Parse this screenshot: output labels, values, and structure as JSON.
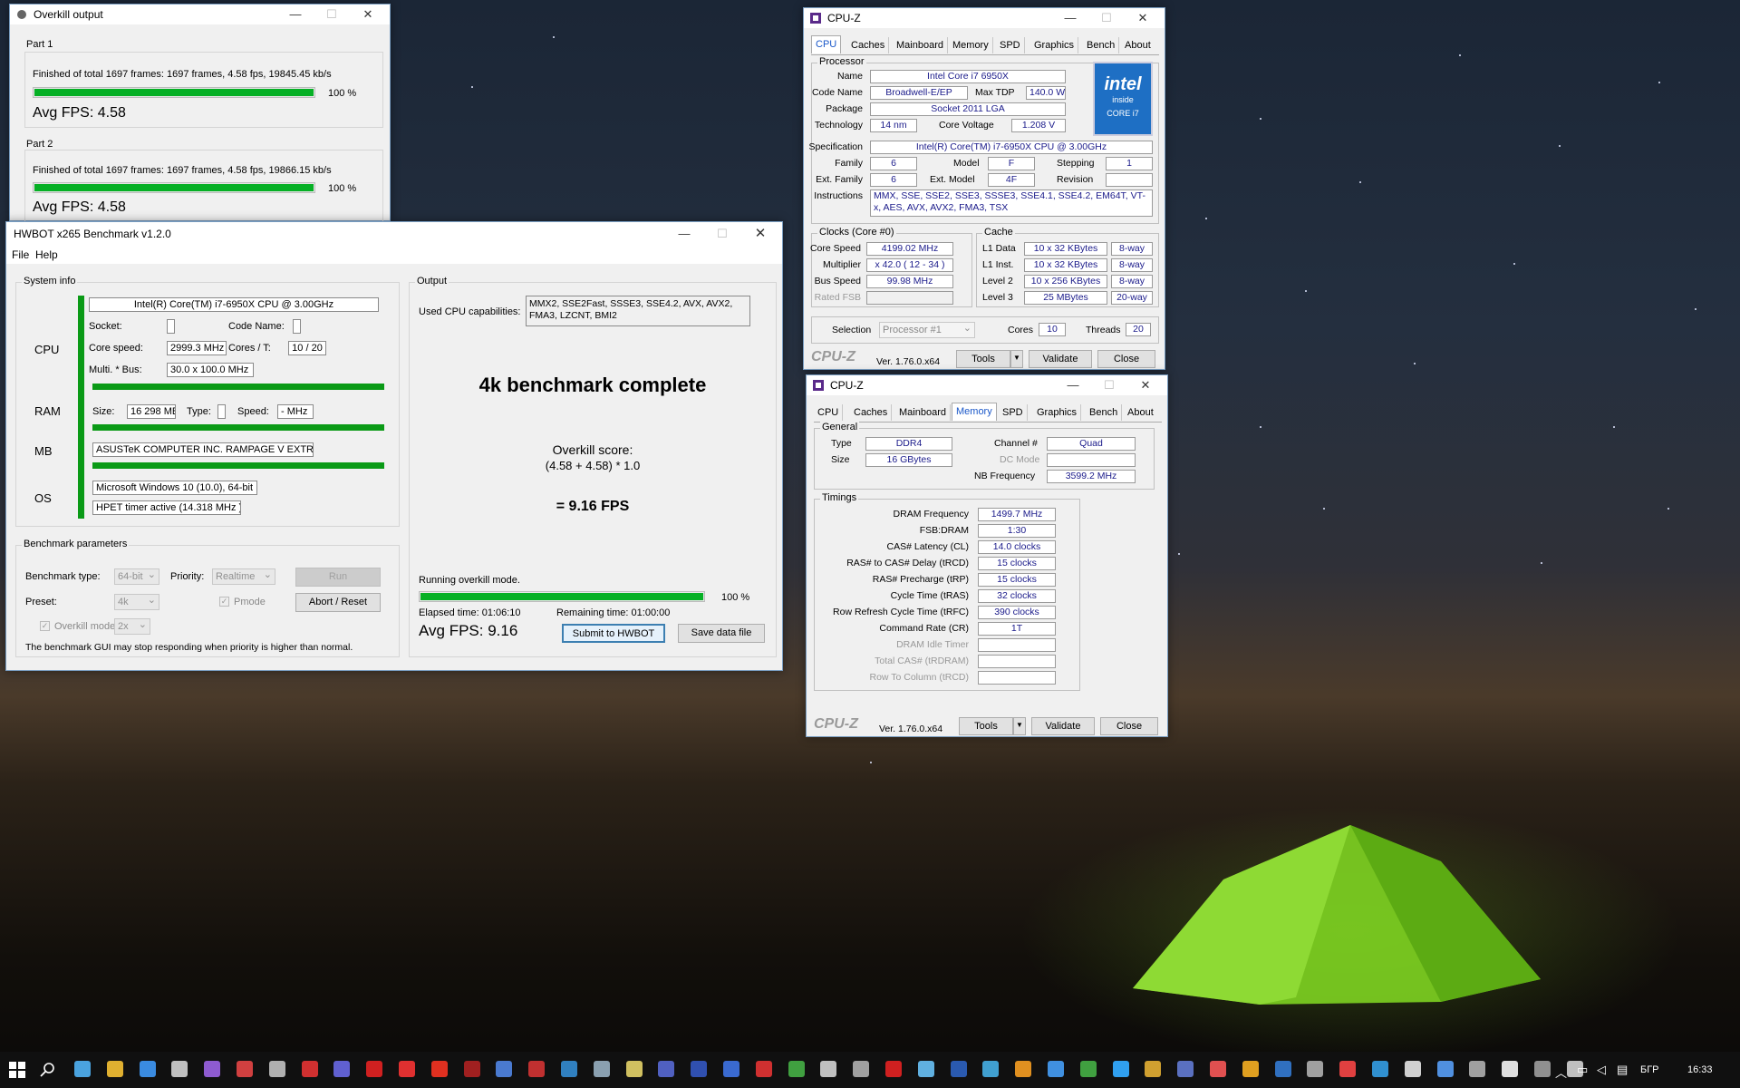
{
  "overkill": {
    "title": "Overkill output",
    "part1": {
      "label": "Part 1",
      "status": "Finished of total 1697 frames: 1697 frames, 4.58 fps,  19845.45 kb/s",
      "pct": "100 %",
      "progress": 1.0,
      "avg": "Avg FPS: 4.58"
    },
    "part2": {
      "label": "Part 2",
      "status": "Finished of total 1697 frames: 1697 frames, 4.58 fps,  19866.15 kb/s",
      "pct": "100 %",
      "progress": 1.0,
      "avg": "Avg FPS: 4.58"
    }
  },
  "hwbot": {
    "title": "HWBOT x265 Benchmark v1.2.0",
    "menu": [
      "File",
      "Help"
    ],
    "sysinfo": {
      "group": "System info",
      "cpu_label": "CPU",
      "ram_label": "RAM",
      "mb_label": "MB",
      "os_label": "OS",
      "cpu_name": "Intel(R) Core(TM) i7-6950X CPU @ 3.00GHz",
      "socket_label": "Socket:",
      "socket": "",
      "codename_label": "Code Name:",
      "codename": "",
      "corespeed_label": "Core speed:",
      "corespeed": "2999.3 MHz",
      "cores_label": "Cores / T:",
      "cores": "10 / 20",
      "multi_label": "Multi. * Bus:",
      "multi": "30.0 x 100.0 MHz",
      "size_label": "Size:",
      "size": "16 298 MB",
      "type_label": "Type:",
      "type": "",
      "speed_label": "Speed:",
      "speed": "- MHz",
      "mb": "ASUSTeK COMPUTER INC. RAMPAGE V EXTREME",
      "os": "Microsoft Windows 10 (10.0), 64-bit",
      "timer": "HPET timer active (14.318 MHz )"
    },
    "params": {
      "group": "Benchmark parameters",
      "type_label": "Benchmark type:",
      "type": "64-bit",
      "priority_label": "Priority:",
      "priority": "Realtime",
      "run": "Run",
      "preset_label": "Preset:",
      "preset": "4k",
      "pmode": "Pmode",
      "abort": "Abort / Reset",
      "overkill_label": "Overkill mode",
      "overkill": "2x",
      "warning": "The benchmark GUI may stop responding when priority is higher than normal."
    },
    "output": {
      "group": "Output",
      "caps_label": "Used CPU capabilities:",
      "caps": "MMX2, SSE2Fast, SSSE3, SSE4.2, AVX, AVX2, FMA3, LZCNT, BMI2",
      "headline": "4k benchmark complete",
      "score_label": "Overkill score:",
      "score_formula": "(4.58 + 4.58) * 1.0",
      "result": "= 9.16 FPS",
      "running": "Running overkill mode.",
      "pct": "100 %",
      "progress": 1.0,
      "elapsed": "Elapsed time: 01:06:10",
      "remaining": "Remaining time: 01:00:00",
      "avg": "Avg FPS: 9.16",
      "submit": "Submit to HWBOT",
      "save": "Save data file"
    }
  },
  "cpuz1": {
    "title": "CPU-Z",
    "tabs": [
      "CPU",
      "Caches",
      "Mainboard",
      "Memory",
      "SPD",
      "Graphics",
      "Bench",
      "About"
    ],
    "active": "CPU",
    "processor": {
      "group": "Processor",
      "name_label": "Name",
      "name": "Intel Core i7 6950X",
      "codename_label": "Code Name",
      "codename": "Broadwell-E/EP",
      "tdp_label": "Max TDP",
      "tdp": "140.0 W",
      "package_label": "Package",
      "package": "Socket 2011 LGA",
      "tech_label": "Technology",
      "tech": "14 nm",
      "voltage_label": "Core Voltage",
      "voltage": "1.208 V",
      "spec_label": "Specification",
      "spec": "Intel(R) Core(TM) i7-6950X CPU @ 3.00GHz",
      "family_label": "Family",
      "family": "6",
      "model_label": "Model",
      "model": "F",
      "stepping_label": "Stepping",
      "stepping": "1",
      "extfamily_label": "Ext. Family",
      "extfamily": "6",
      "extmodel_label": "Ext. Model",
      "extmodel": "4F",
      "revision_label": "Revision",
      "revision": "",
      "instr_label": "Instructions",
      "instr": "MMX, SSE, SSE2, SSE3, SSSE3, SSE4.1, SSE4.2, EM64T, VT-x, AES, AVX, AVX2, FMA3, TSX"
    },
    "logo": {
      "brand": "intel",
      "inside": "inside",
      "line": "CORE i7"
    },
    "clocks": {
      "group": "Clocks (Core #0)",
      "core_label": "Core Speed",
      "core": "4199.02 MHz",
      "mult_label": "Multiplier",
      "mult": "x 42.0 ( 12 - 34 )",
      "bus_label": "Bus Speed",
      "bus": "99.98 MHz",
      "fsb_label": "Rated FSB",
      "fsb": ""
    },
    "cache": {
      "group": "Cache",
      "l1d_label": "L1 Data",
      "l1d": "10 x 32 KBytes",
      "l1d_w": "8-way",
      "l1i_label": "L1 Inst.",
      "l1i": "10 x 32 KBytes",
      "l1i_w": "8-way",
      "l2_label": "Level 2",
      "l2": "10 x 256 KBytes",
      "l2_w": "8-way",
      "l3_label": "Level 3",
      "l3": "25 MBytes",
      "l3_w": "20-way"
    },
    "sel_label": "Selection",
    "sel": "Processor #1",
    "cores_label": "Cores",
    "cores": "10",
    "threads_label": "Threads",
    "threads": "20",
    "brand": "CPU-Z",
    "ver": "Ver. 1.76.0.x64",
    "tools": "Tools",
    "validate": "Validate",
    "close": "Close"
  },
  "cpuz2": {
    "title": "CPU-Z",
    "tabs": [
      "CPU",
      "Caches",
      "Mainboard",
      "Memory",
      "SPD",
      "Graphics",
      "Bench",
      "About"
    ],
    "active": "Memory",
    "general": {
      "group": "General",
      "type_label": "Type",
      "type": "DDR4",
      "channel_label": "Channel #",
      "channel": "Quad",
      "size_label": "Size",
      "size": "16 GBytes",
      "dc_label": "DC Mode",
      "dc": "",
      "nb_label": "NB Frequency",
      "nb": "3599.2 MHz"
    },
    "timings": {
      "group": "Timings",
      "rows": [
        {
          "label": "DRAM Frequency",
          "value": "1499.7 MHz",
          "dis": false
        },
        {
          "label": "FSB:DRAM",
          "value": "1:30",
          "dis": false
        },
        {
          "label": "CAS# Latency (CL)",
          "value": "14.0 clocks",
          "dis": false
        },
        {
          "label": "RAS# to CAS# Delay (tRCD)",
          "value": "15 clocks",
          "dis": false
        },
        {
          "label": "RAS# Precharge (tRP)",
          "value": "15 clocks",
          "dis": false
        },
        {
          "label": "Cycle Time (tRAS)",
          "value": "32 clocks",
          "dis": false
        },
        {
          "label": "Row Refresh Cycle Time (tRFC)",
          "value": "390 clocks",
          "dis": false
        },
        {
          "label": "Command Rate (CR)",
          "value": "1T",
          "dis": false
        },
        {
          "label": "DRAM Idle Timer",
          "value": "",
          "dis": true
        },
        {
          "label": "Total CAS# (tRDRAM)",
          "value": "",
          "dis": true
        },
        {
          "label": "Row To Column (tRCD)",
          "value": "",
          "dis": true
        }
      ]
    },
    "brand": "CPU-Z",
    "ver": "Ver. 1.76.0.x64",
    "tools": "Tools",
    "validate": "Validate",
    "close": "Close"
  },
  "taskbar": {
    "lang": "БГР",
    "time": "16:33",
    "icon_colors": [
      "#4aa3df",
      "#e0b030",
      "#3a8be0",
      "#c0c0c0",
      "#8e5bd0",
      "#d04040",
      "#b0b0b0",
      "#d03030",
      "#6060d0",
      "#d02020",
      "#e03030",
      "#e03020",
      "#a02020",
      "#4a7ad0",
      "#c03030",
      "#3080c0",
      "#8aa0b0",
      "#d0c060",
      "#5060c0",
      "#3050b0",
      "#3a6ad0",
      "#d03030",
      "#40a040",
      "#c0c0c0",
      "#a0a0a0",
      "#d02020",
      "#60b0e0",
      "#2a5ab0",
      "#40a0d0",
      "#e09020",
      "#4090e0",
      "#40a040",
      "#30a0f0",
      "#d0a030",
      "#5a70c0",
      "#e05050",
      "#e0a020",
      "#3070c0",
      "#a0a0a0",
      "#e04040",
      "#3090d0",
      "#d0d0d0",
      "#5090e0",
      "#a0a0a0",
      "#e0e0e0",
      "#909090",
      "#c0c0c0"
    ]
  }
}
